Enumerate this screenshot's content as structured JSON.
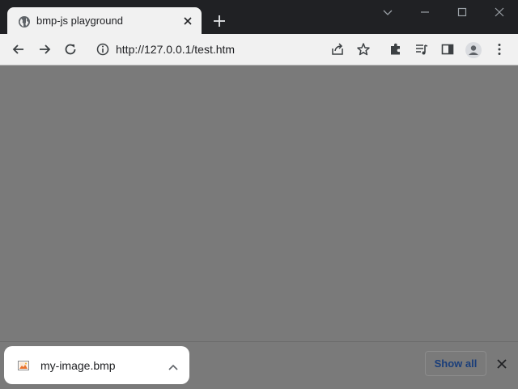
{
  "browser": {
    "tab": {
      "title": "bmp-js playground",
      "favicon": "globe-icon"
    },
    "new_tab_icon": "plus-icon",
    "window_controls": [
      "chevron-down-icon",
      "minimize-icon",
      "maximize-icon",
      "close-icon"
    ]
  },
  "toolbar": {
    "back_icon": "arrow-left-icon",
    "forward_icon": "arrow-right-icon",
    "reload_icon": "reload-icon",
    "site_info_icon": "info-icon",
    "url": "http://127.0.0.1/test.htm",
    "right_icons": [
      "share-icon",
      "star-icon",
      "extensions-icon",
      "media-icon",
      "side-panel-icon",
      "profile-icon",
      "more-icon"
    ]
  },
  "download_shelf": {
    "item": {
      "filename": "my-image.bmp",
      "file_icon": "image-file-icon",
      "expand_icon": "chevron-up-icon"
    },
    "show_all_label": "Show all",
    "close_icon": "close-icon"
  },
  "colors": {
    "titlebar": "#202124",
    "toolbar": "#f1f1f1",
    "content_dimmed": "#7a7a7a",
    "show_all_text": "#1a3e7a"
  }
}
